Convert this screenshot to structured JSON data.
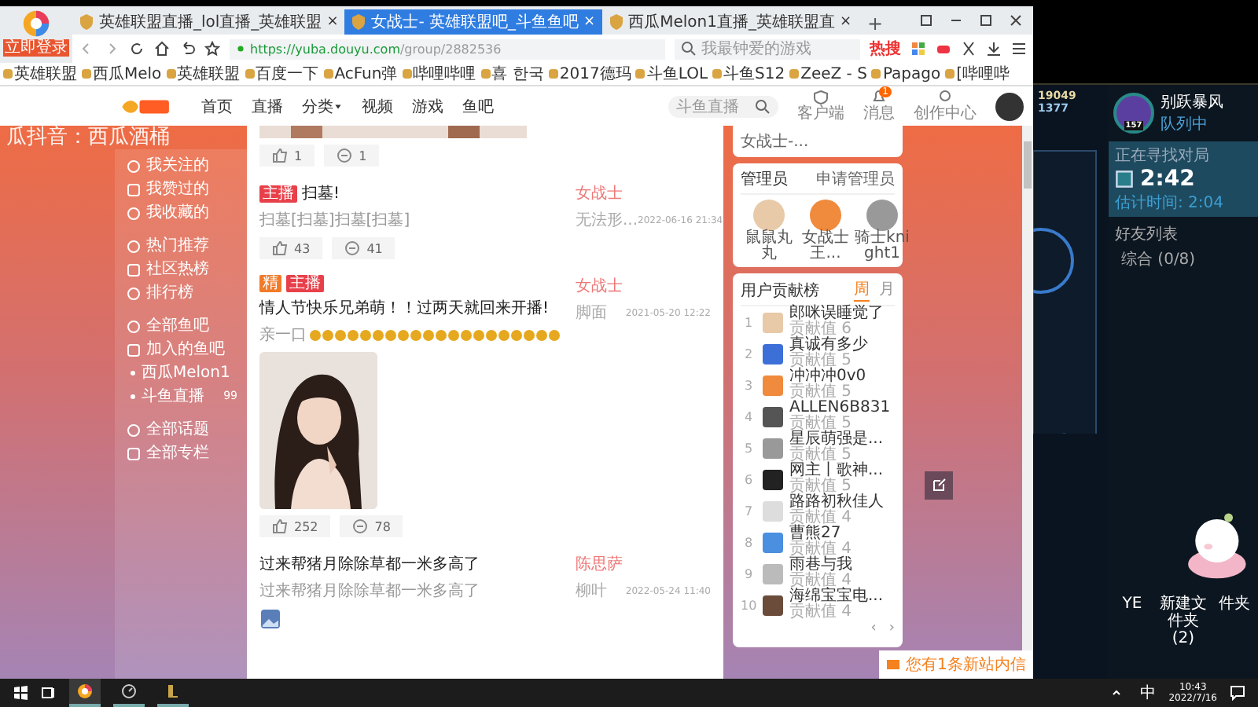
{
  "browser": {
    "badge": "立即登录",
    "tabs": [
      {
        "label": "英雄联盟直播_lol直播_英雄联盟",
        "close": "×",
        "selected": false
      },
      {
        "label": "女战士- 英雄联盟吧_斗鱼鱼吧",
        "close": "×",
        "selected": true
      },
      {
        "label": "西瓜Melon1直播_英雄联盟直",
        "close": "×",
        "selected": false
      }
    ],
    "new_tab": "+",
    "url_host": "https://yuba.douyu.com",
    "url_path": "/group/2882536",
    "search_placeholder": "我最钟爱的游戏",
    "hot": "热搜",
    "bookmarks": [
      "英雄联盟",
      "西瓜Melo",
      "英雄联盟",
      "百度一下",
      "AcFun弹",
      "哔哩哔哩",
      "喜 한국",
      "2017德玛",
      "斗鱼LOL",
      "斗鱼S12",
      "ZeeZ - S",
      "Papago",
      "[哔哩哔"
    ]
  },
  "site": {
    "nav": [
      {
        "label": "首页",
        "dropdown": false
      },
      {
        "label": "直播",
        "dropdown": false
      },
      {
        "label": "分类",
        "dropdown": true
      },
      {
        "label": "视频",
        "dropdown": false
      },
      {
        "label": "游戏",
        "dropdown": false
      },
      {
        "label": "鱼吧",
        "dropdown": false
      }
    ],
    "search_placeholder": "斗鱼直播",
    "tools": [
      {
        "label": "客户端",
        "kind": "client"
      },
      {
        "label": "消息",
        "kind": "bell",
        "badge": "1"
      },
      {
        "label": "创作中心",
        "kind": "bulb"
      }
    ],
    "banner_title": "瓜抖音：西瓜酒桶"
  },
  "sidebar": [
    [
      {
        "label": "我关注的",
        "kind": "link"
      },
      {
        "label": "我赞过的",
        "kind": "link"
      },
      {
        "label": "我收藏的",
        "kind": "link"
      }
    ],
    [
      {
        "label": "热门推荐",
        "kind": "link"
      },
      {
        "label": "社区热榜",
        "kind": "link"
      },
      {
        "label": "排行榜",
        "kind": "link"
      }
    ],
    [
      {
        "label": "全部鱼吧",
        "kind": "link"
      },
      {
        "label": "加入的鱼吧",
        "kind": "link"
      },
      {
        "label": "西瓜Melon1",
        "kind": "sub"
      },
      {
        "label": "斗鱼直播",
        "kind": "sub",
        "count": "99"
      }
    ],
    [
      {
        "label": "全部话题",
        "kind": "link"
      },
      {
        "label": "全部专栏",
        "kind": "link"
      }
    ]
  ],
  "posts": [
    {
      "kind": "tail",
      "likes": "1",
      "comments": "1"
    },
    {
      "kind": "text",
      "tags": [
        {
          "label": "主播",
          "kind": "host"
        }
      ],
      "title": "扫墓!",
      "body": "扫墓[扫墓]扫墓[扫墓]",
      "author": "女战士",
      "reply": "无法形...",
      "date": "2022-06-16 21:34",
      "likes": "43",
      "comments": "41"
    },
    {
      "tags": [
        {
          "label": "精",
          "kind": "best"
        },
        {
          "label": "主播",
          "kind": "host"
        }
      ],
      "title": "情人节快乐兄弟萌！！过两天就回来开播!",
      "body": "亲一口",
      "emoji_row": true,
      "author": "女战士",
      "reply": "脚面",
      "date": "2021-05-20 12:22",
      "likes": "252",
      "comments": "78"
    },
    {
      "kind": "thumb",
      "title": "过来帮猪月除除草都一米多高了",
      "body": "过来帮猪月除除草都一米多高了",
      "author": "陈思萨",
      "reply": "柳叶",
      "date": "2022-05-24 11:40"
    }
  ],
  "right": {
    "top_name": "女战士-...",
    "admins": {
      "title": "管理员",
      "action": "申请管理员",
      "members": [
        "鼠鼠丸丸",
        "女战士王...",
        "骑士knight1"
      ]
    },
    "ranking": {
      "title": "用户贡献榜",
      "tabs": [
        {
          "label": "周",
          "selected": true
        },
        {
          "label": "月",
          "selected": false
        }
      ],
      "rows": [
        {
          "rank": "1",
          "name": "郎咪误睡觉了",
          "score": "贡献值 6"
        },
        {
          "rank": "2",
          "name": "真诚有多少",
          "score": "贡献值 5"
        },
        {
          "rank": "3",
          "name": "冲冲冲0v0",
          "score": "贡献值 5"
        },
        {
          "rank": "4",
          "name": "ALLEN6B831",
          "score": "贡献值 5"
        },
        {
          "rank": "5",
          "name": "星辰萌强是...",
          "score": "贡献值 5"
        },
        {
          "rank": "6",
          "name": "网主丨歌神...",
          "score": "贡献值 5"
        },
        {
          "rank": "7",
          "name": "路路初秋佳人",
          "score": "贡献值 4"
        },
        {
          "rank": "8",
          "name": "曹熊27",
          "score": "贡献值 4"
        },
        {
          "rank": "9",
          "name": "雨巷与我",
          "score": "贡献值 4"
        },
        {
          "rank": "10",
          "name": "海绵宝宝电...",
          "score": "贡献值 4"
        }
      ],
      "prev": "‹",
      "next": "›"
    },
    "notice": "您有1条新站内信"
  },
  "game": {
    "currency": [
      "19049",
      "1377"
    ],
    "player": {
      "name": "别跃暴风",
      "status": "队列中",
      "badge": "157"
    },
    "queue": {
      "title": "正在寻找对局",
      "time": "2:42",
      "estimate": "估计时间: 2:04"
    },
    "friends": {
      "title": "好友列表",
      "group": "综合 (0/8)"
    },
    "desktop_icons": [
      "YE",
      "新建文件夹 (2)",
      "件夹"
    ]
  },
  "taskbar": {
    "lang": "中",
    "time": "10:43",
    "date": "2022/7/16"
  }
}
